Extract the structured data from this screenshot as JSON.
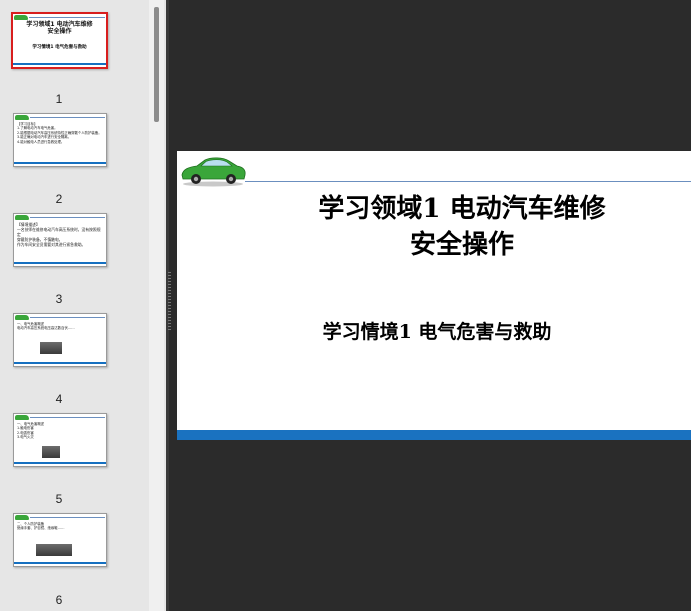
{
  "colors": {
    "app_background": "#2b2b2b",
    "thumbnail_pane": "#e6e6e6",
    "selection_border": "#d81e1e",
    "accent_bar": "#1a72c0",
    "car_green": "#3aa63a"
  },
  "slide": {
    "title": "学习领域1  电动汽车维修\n安全操作",
    "subtitle": "学习情境1  电气危害与救助"
  },
  "thumbnails": [
    {
      "number": "",
      "selected": true,
      "kind": "title",
      "title": "学习领域1  电动汽车维修\n安全操作",
      "subtitle": "学习情境1  电气危害与救助"
    },
    {
      "number": "1",
      "selected": false,
      "kind": "text",
      "text": "【学习目标】\n1.了解电动汽车电气危害。\n2.能根据电动汽车高压系统特性正确穿戴个人防护装备。\n3.能正确对电动汽车进行安全隔离。\n4.能对触电人员进行急救处理。"
    },
    {
      "number": "2",
      "selected": false,
      "kind": "text",
      "text": "【情境描述】\n一名技师在维修电动汽车高压系统时，没有按照规定\n穿戴防护装备，不慎触电，\n作为车间安全员需要对其进行紧急救助。"
    },
    {
      "number": "3",
      "selected": false,
      "kind": "photo",
      "text": "一、电气危害概述\n电动汽车高压系统电压高达数百伏……"
    },
    {
      "number": "4",
      "selected": false,
      "kind": "photo",
      "text": "一、电气危害概述\n1.触电伤害\n2.电弧伤害\n3.电气火灾"
    },
    {
      "number": "5",
      "selected": false,
      "kind": "photo",
      "text": "二、个人防护装备\n绝缘手套、护目镜、绝缘鞋……"
    },
    {
      "number": "6",
      "selected": false,
      "kind": "photo",
      "text": ""
    }
  ]
}
